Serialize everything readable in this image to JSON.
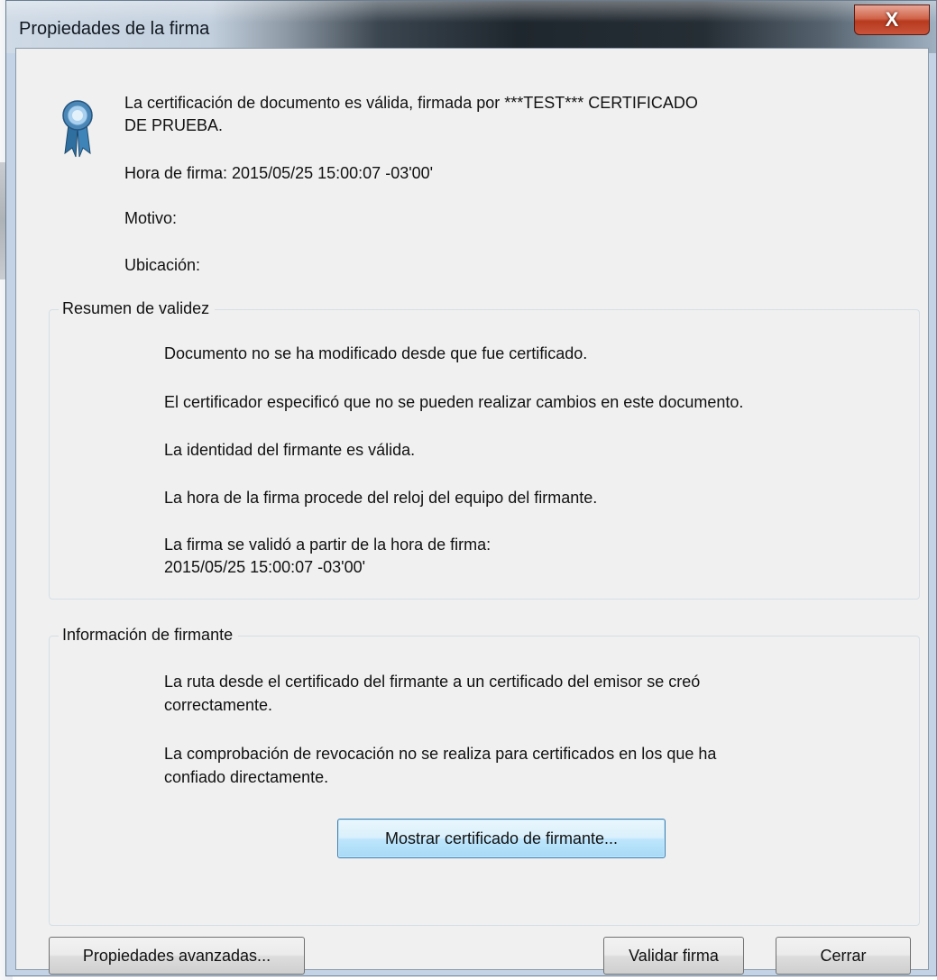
{
  "window": {
    "title": "Propiedades de la firma",
    "close_glyph": "X"
  },
  "summary": {
    "icon": "certificate-ribbon-icon",
    "certification_line1": "La certificación de documento es válida, firmada por ***TEST*** CERTIFICADO",
    "certification_line2": "DE PRUEBA.",
    "signing_time": "Hora de firma:  2015/05/25 15:00:07 -03'00'",
    "reason": "Motivo:",
    "location": "Ubicación:"
  },
  "validity": {
    "title": "Resumen de validez",
    "items": [
      "Documento no se ha modificado desde que fue certificado.",
      "El certificador especificó que no se pueden realizar cambios en este documento.",
      "La identidad del firmante es válida.",
      "La hora de la firma procede del reloj del equipo del firmante.",
      "La firma se validó a partir de la hora de firma:"
    ],
    "validated_time": "2015/05/25 15:00:07 -03'00'"
  },
  "signer": {
    "title": "Información de firmante",
    "path_line1": "La ruta desde el certificado del firmante a un certificado del emisor se creó",
    "path_line2": "correctamente.",
    "revocation_line1": "La comprobación de revocación no se realiza para certificados en los que ha",
    "revocation_line2": "confiado directamente.",
    "show_cert_button": "Mostrar certificado de firmante..."
  },
  "footer": {
    "advanced_button": "Propiedades avanzadas...",
    "validate_button": "Validar firma",
    "close_button": "Cerrar"
  },
  "colors": {
    "dialog_bg": "#f0f0f0",
    "close_button_red": "#c9533a",
    "ribbon_blue": "#4a86b6"
  }
}
